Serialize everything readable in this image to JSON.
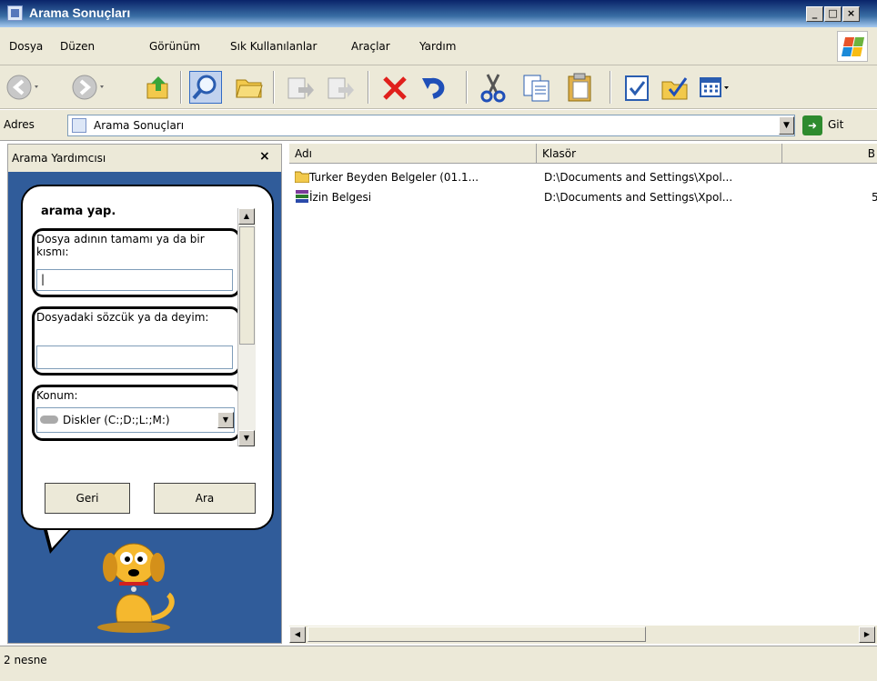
{
  "window": {
    "title": "Arama Sonuçları"
  },
  "menu": [
    {
      "label": "Dosya"
    },
    {
      "label": "Düzen"
    },
    {
      "label": "Görünüm"
    },
    {
      "label": "Sık Kullanılanlar"
    },
    {
      "label": "Araçlar"
    },
    {
      "label": "Yardım"
    }
  ],
  "toolbar": [
    {
      "name": "back-icon"
    },
    {
      "name": "forward-icon"
    },
    {
      "name": "up-folder-icon"
    },
    {
      "name": "search-icon"
    },
    {
      "name": "folders-icon"
    },
    {
      "name": "move-to-icon"
    },
    {
      "name": "copy-to-icon"
    },
    {
      "name": "delete-icon"
    },
    {
      "name": "undo-icon"
    },
    {
      "name": "cut-icon"
    },
    {
      "name": "copy-icon"
    },
    {
      "name": "paste-icon"
    },
    {
      "name": "properties-icon"
    },
    {
      "name": "folder-options-icon"
    },
    {
      "name": "views-icon"
    }
  ],
  "address": {
    "label": "Adres",
    "value": "Arama Sonuçları",
    "go": "Git"
  },
  "search_pane": {
    "title": "Arama Yardımcısı",
    "heading": "arama yap.",
    "filename_label": "Dosya adının tamamı ya da bir kısmı:",
    "filename_value": "|",
    "phrase_label": "Dosyadaki sözcük ya da deyim:",
    "phrase_value": "",
    "location_label": "Konum:",
    "location_value": "Diskler (C:;D:;L:;M:)",
    "back_button": "Geri",
    "search_button": "Ara"
  },
  "list": {
    "columns": [
      "Adı",
      "Klasör",
      "B"
    ],
    "rows": [
      {
        "name": "Turker Beyden Belgeler (01.1...",
        "folder": "D:\\Documents and Settings\\Xpol...",
        "size": ""
      },
      {
        "name": "İzin Belgesi",
        "folder": "D:\\Documents and Settings\\Xpol...",
        "size": "5"
      }
    ]
  },
  "status": {
    "text": "2 nesne"
  }
}
